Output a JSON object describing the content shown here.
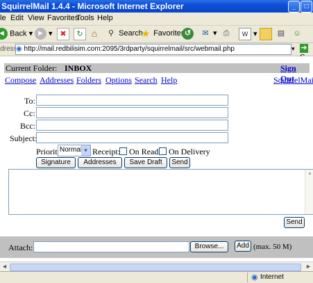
{
  "window": {
    "title": "SquirrelMail 1.4.4 - Microsoft Internet Explorer"
  },
  "menubar": [
    "le",
    "Edit",
    "View",
    "Favorites",
    "Tools",
    "Help"
  ],
  "toolbar": {
    "back": "Back",
    "search": "Search",
    "favorites": "Favorites"
  },
  "address": {
    "label": "ldress",
    "url": "http://mail.redbilisim.com:2095/3rdparty/squirrelmail/src/webmail.php",
    "go": "G"
  },
  "page": {
    "folder_label": "Current Folder:",
    "folder_name": "INBOX",
    "sign_out": "Sign Out",
    "nav": [
      "Compose",
      "Addresses",
      "Folders",
      "Options",
      "Search",
      "Help"
    ],
    "brand": "SquirrelMail"
  },
  "compose": {
    "to_label": "To:",
    "cc_label": "Cc:",
    "bcc_label": "Bcc:",
    "subject_label": "Subject:",
    "to_value": "",
    "cc_value": "",
    "bcc_value": "",
    "subject_value": "",
    "priority_label": "Priority",
    "priority_value": "Normal",
    "receipt_label": "Receipt:",
    "on_read": "On Read",
    "on_delivery": "On Delivery",
    "signature_btn": "Signature",
    "addresses_btn": "Addresses",
    "save_draft_btn": "Save Draft",
    "send_btn": "Send",
    "body_value": "",
    "send_btn_bottom": "Send"
  },
  "attach": {
    "label": "Attach:",
    "browse_btn": "Browse...",
    "add_btn": "Add",
    "max_text": "(max. 50 M)"
  },
  "status": {
    "zone": "Internet"
  },
  "colors": {
    "titlebar": "#0b4fd6",
    "link": "#0000cc",
    "chrome": "#ece9d8",
    "bar": "#c0c0c0"
  }
}
